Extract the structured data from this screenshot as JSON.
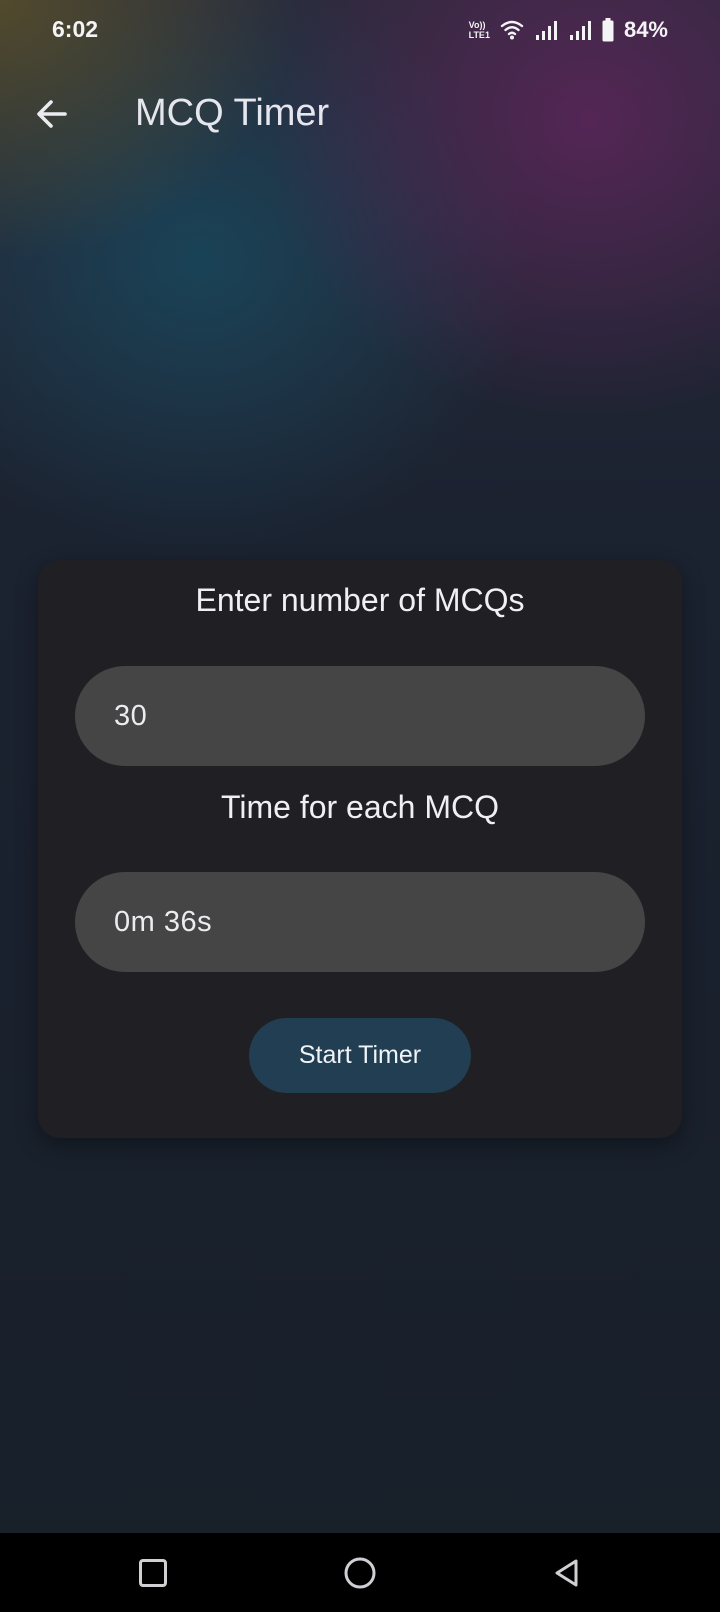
{
  "status_bar": {
    "time": "6:02",
    "volte_top": "Vo))",
    "volte_bottom": "LTE1",
    "battery_percent": "84%",
    "icons": [
      "volte-icon",
      "wifi-icon",
      "signal-icon",
      "signal-icon",
      "battery-icon"
    ]
  },
  "app_bar": {
    "back_icon": "arrow-left-icon",
    "title": "MCQ Timer"
  },
  "form": {
    "mcq_count_label": "Enter number of MCQs",
    "mcq_count_value": "30",
    "time_each_label": "Time for each MCQ",
    "time_each_value": "0m 36s",
    "start_button_label": "Start Timer"
  },
  "nav_bar": {
    "icons": [
      "recents-square-icon",
      "home-circle-icon",
      "back-triangle-icon"
    ]
  },
  "colors": {
    "card_background": "#201f24",
    "field_background": "#454545",
    "button_background": "#213e52",
    "text_primary": "#f0f0f4",
    "nav_background": "#000000"
  }
}
